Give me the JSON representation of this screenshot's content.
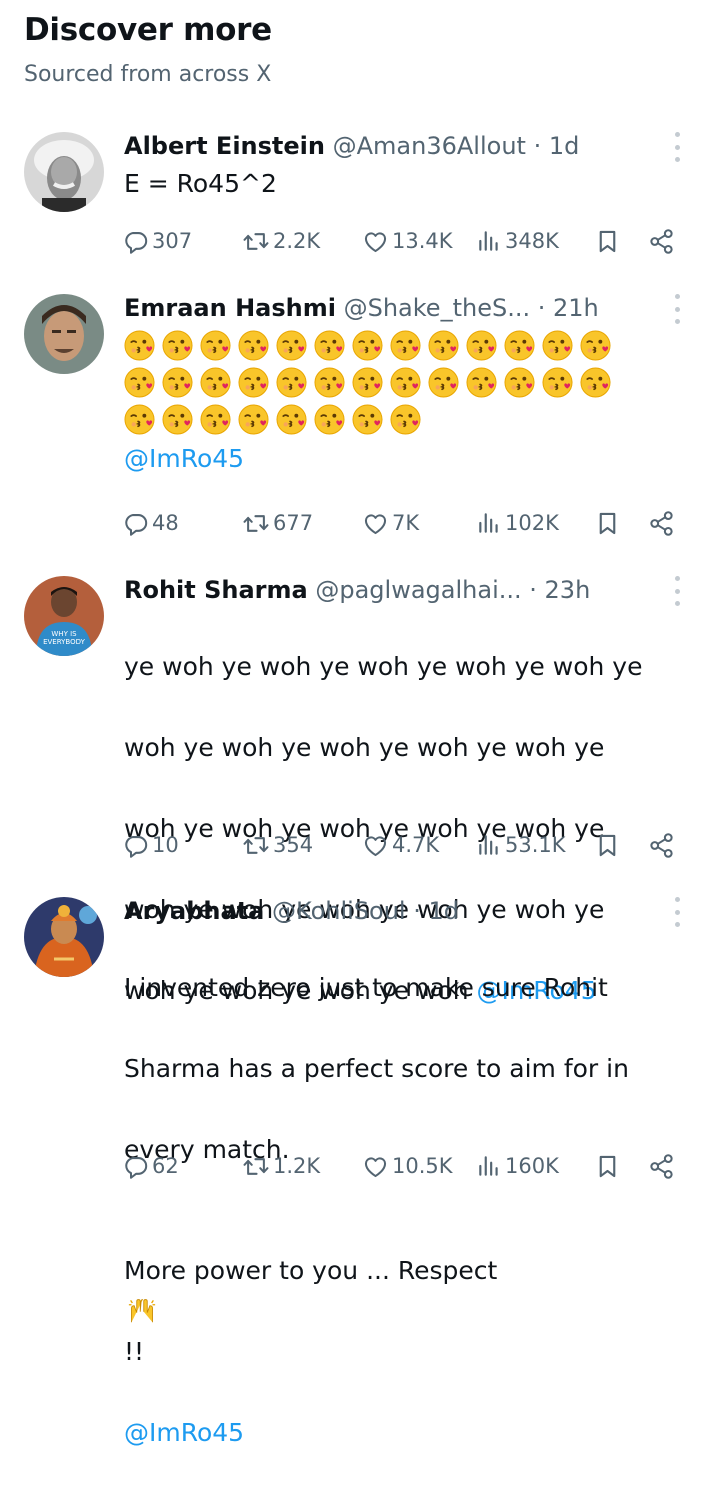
{
  "section": {
    "title": "Discover more",
    "subtitle": "Sourced from across X"
  },
  "tweets": [
    {
      "name": "Albert Einstein",
      "handle": "@Aman36Allout",
      "time": "1d",
      "text": "E = Ro45^2",
      "mention": "",
      "replies": "307",
      "reposts": "2.2K",
      "likes": "13.4K",
      "views": "348K"
    },
    {
      "name": "Emraan Hashmi",
      "handle": "@Shake_theS...",
      "time": "21h",
      "emoji": "face-throwing-a-kiss",
      "emoji_rows": [
        13,
        13,
        8
      ],
      "mention": "@ImRo45",
      "replies": "48",
      "reposts": "677",
      "likes": "7K",
      "views": "102K"
    },
    {
      "name": "Rohit Sharma",
      "handle": "@paglwagalhai...",
      "time": "23h",
      "text_lines": [
        "ye woh ye woh ye woh ye woh ye woh ye",
        "woh ye woh ye woh ye woh ye woh ye",
        "woh ye woh ye woh ye woh ye woh ye",
        "woh ye woh ye woh ye woh ye woh ye",
        "woh ye woh ye woh ye woh"
      ],
      "mention": "@ImRo45",
      "replies": "10",
      "reposts": "354",
      "likes": "4.7K",
      "views": "53.1K"
    },
    {
      "name": "Aryabhata",
      "handle": "@KohliSoul",
      "time": "1d",
      "text_lines": [
        "I invented zero just to make sure Rohit",
        "Sharma has a perfect score to aim for in",
        "every match.",
        "More power to you ... Respect"
      ],
      "suffix": "!!",
      "suffix_emoji": "raising-hands",
      "mention": "@ImRo45",
      "replies": "62",
      "reposts": "1.2K",
      "likes": "10.5K",
      "views": "160K"
    }
  ],
  "icons": {
    "reply": "reply-icon",
    "repost": "repost-icon",
    "like": "like-icon",
    "views": "views-icon",
    "bookmark": "bookmark-icon",
    "share": "share-icon",
    "more": "more-options-icon"
  },
  "colors": {
    "text": "#0f1419",
    "secondary": "#536471",
    "link": "#1d9bf0"
  }
}
